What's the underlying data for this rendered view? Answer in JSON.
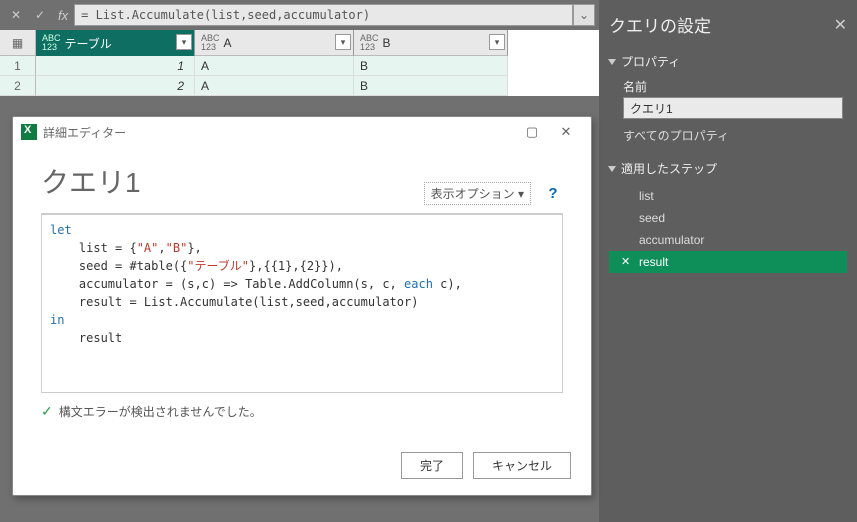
{
  "formula_bar": {
    "fx": "fx",
    "formula": "= List.Accumulate(list,seed,accumulator)"
  },
  "grid": {
    "type_label": "ABC\n123",
    "columns": [
      "テーブル",
      "A",
      "B"
    ],
    "rows": [
      {
        "n": "1",
        "c0": "1",
        "c1": "A",
        "c2": "B"
      },
      {
        "n": "2",
        "c0": "2",
        "c1": "A",
        "c2": "B"
      }
    ]
  },
  "settings": {
    "title": "クエリの設定",
    "props_section": "プロパティ",
    "name_label": "名前",
    "name_value": "クエリ1",
    "all_props": "すべてのプロパティ",
    "steps_section": "適用したステップ",
    "steps": [
      "list",
      "seed",
      "accumulator",
      "result"
    ],
    "selected_step": "result"
  },
  "dialog": {
    "title": "詳細エディター",
    "heading": "クエリ1",
    "display_options": "表示オプション",
    "code": {
      "kw_let": "let",
      "l1a": "    list = {",
      "l1s1": "\"A\"",
      "l1b": ",",
      "l1s2": "\"B\"",
      "l1c": "},",
      "l2a": "    seed = #table({",
      "l2s": "\"テーブル\"",
      "l2b": "},{{1},{2}}),",
      "l3a": "    accumulator = (s,c) => Table.AddColumn(s, c, ",
      "l3kw": "each",
      "l3b": " c),",
      "l4": "    result = List.Accumulate(list,seed,accumulator)",
      "kw_in": "in",
      "l5": "    result"
    },
    "status": "構文エラーが検出されませんでした。",
    "ok": "完了",
    "cancel": "キャンセル"
  }
}
